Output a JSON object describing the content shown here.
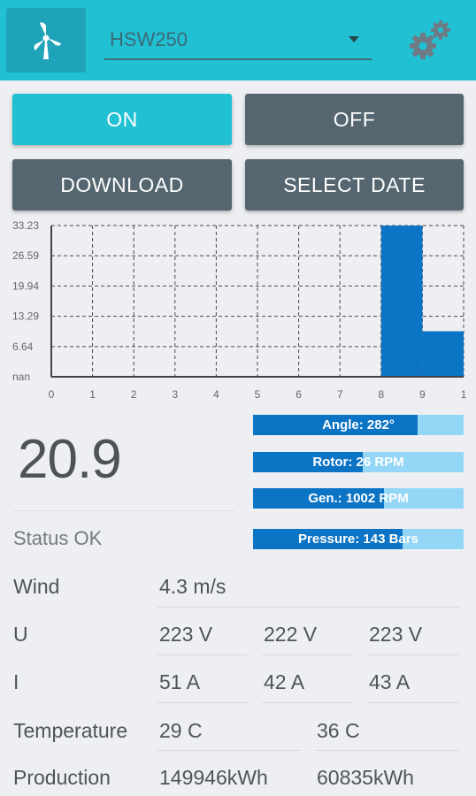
{
  "header": {
    "app_icon": "wind-turbine-icon",
    "device": "HSW250",
    "settings_icon": "gears-icon"
  },
  "buttons": {
    "on": "ON",
    "off": "OFF",
    "download": "DOWNLOAD",
    "select_date": "SELECT DATE"
  },
  "chart_data": {
    "type": "bar",
    "x_ticks": [
      "0",
      "1",
      "2",
      "3",
      "4",
      "5",
      "6",
      "7",
      "8",
      "9",
      "1"
    ],
    "y_ticks": [
      "nan",
      "6.64",
      "13.29",
      "19.94",
      "26.59",
      "33.23"
    ],
    "ylim": [
      0,
      33.23
    ],
    "bars": [
      {
        "x_start": 8,
        "x_end": 9,
        "value": 33.23
      },
      {
        "x_start": 9,
        "x_end": 10,
        "value": 10.0
      }
    ],
    "grid": true,
    "colors": {
      "bar": "#0c74c4"
    }
  },
  "main_value": "20.9",
  "gauges": [
    {
      "label": "Angle: 282°",
      "fill": 0.78
    },
    {
      "label": "Rotor: 26 RPM",
      "fill": 0.52
    },
    {
      "label": "Gen.: 1002 RPM",
      "fill": 0.62
    },
    {
      "label": "Pressure: 143 Bars",
      "fill": 0.71
    }
  ],
  "status": "Status OK",
  "table": {
    "wind": {
      "label": "Wind",
      "values": [
        "4.3 m/s"
      ]
    },
    "u": {
      "label": "U",
      "values": [
        "223 V",
        "222 V",
        "223 V"
      ]
    },
    "i": {
      "label": "I",
      "values": [
        "51 A",
        "42 A",
        "43 A"
      ]
    },
    "temperature": {
      "label": "Temperature",
      "values": [
        "29 C",
        "36 C"
      ]
    },
    "production": {
      "label": "Production",
      "values": [
        "149946kWh",
        "60835kWh"
      ]
    }
  },
  "colors": {
    "accent": "#21c0d3",
    "button_dark": "#556670",
    "gauge_fill": "#0c74c4",
    "gauge_bg": "#94d6f5"
  }
}
